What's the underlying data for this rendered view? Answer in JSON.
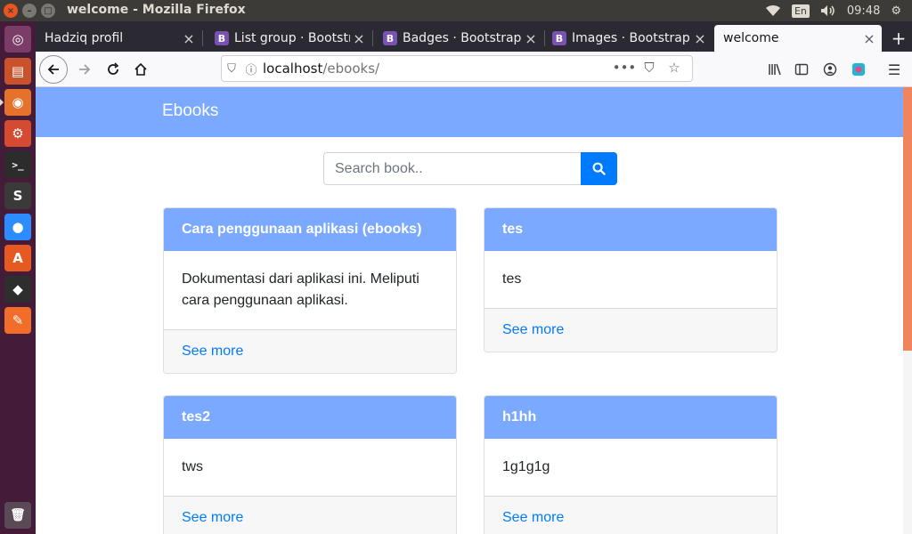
{
  "window": {
    "title": "welcome - Mozilla Firefox"
  },
  "system_tray": {
    "lang": "En",
    "time": "09:48"
  },
  "launcher": {
    "items": [
      {
        "name": "ubuntu-dash-icon",
        "color": "#7b3d68",
        "glyph": "◎"
      },
      {
        "name": "file-manager-icon",
        "color": "#c9522a",
        "glyph": "▤"
      },
      {
        "name": "firefox-icon",
        "color": "#e6712b",
        "glyph": "◉"
      },
      {
        "name": "system-settings-icon",
        "color": "#d54b32",
        "glyph": "⚙"
      },
      {
        "name": "terminal-icon",
        "color": "#2c2c2c",
        "glyph": ">_"
      },
      {
        "name": "sublime-text-icon",
        "color": "#3a3a3a",
        "glyph": "S"
      },
      {
        "name": "zoom-icon",
        "color": "#2d8cff",
        "glyph": "●"
      },
      {
        "name": "software-center-icon",
        "color": "#e65a22",
        "glyph": "A"
      },
      {
        "name": "inkscape-icon",
        "color": "#2e2e2e",
        "glyph": "◆"
      },
      {
        "name": "web-browser-icon",
        "color": "#f36d2a",
        "glyph": "✎"
      }
    ],
    "trash": {
      "name": "trash-icon",
      "glyph": "🗑"
    }
  },
  "tabs": [
    {
      "label": "Hadziq profil",
      "favicon": ""
    },
    {
      "label": "List group · Bootstrap",
      "favicon": "B"
    },
    {
      "label": "Badges · Bootstrap",
      "favicon": "B"
    },
    {
      "label": "Images · Bootstrap",
      "favicon": "B"
    },
    {
      "label": "welcome",
      "favicon": "",
      "active": true
    }
  ],
  "navbar": {
    "url_host": "localhost",
    "url_path": "/ebooks/"
  },
  "site": {
    "brand": "Ebooks",
    "search": {
      "placeholder": "Search book.."
    },
    "cards": [
      {
        "title": "Cara penggunaan aplikasi (ebooks)",
        "body": "Dokumentasi dari aplikasi ini. Meliputi cara penggunaan aplikasi.",
        "link": "See more"
      },
      {
        "title": "tes",
        "body": "tes",
        "link": "See more"
      },
      {
        "title": "tes2",
        "body": "tws",
        "link": "See more"
      },
      {
        "title": "h1hh",
        "body": "1g1g1g",
        "link": "See more"
      }
    ]
  },
  "colors": {
    "accent_header": "#7aa9ff",
    "primary": "#007bff",
    "launcher_bg": "#451b3a",
    "scrollbar": "#f0845c"
  }
}
